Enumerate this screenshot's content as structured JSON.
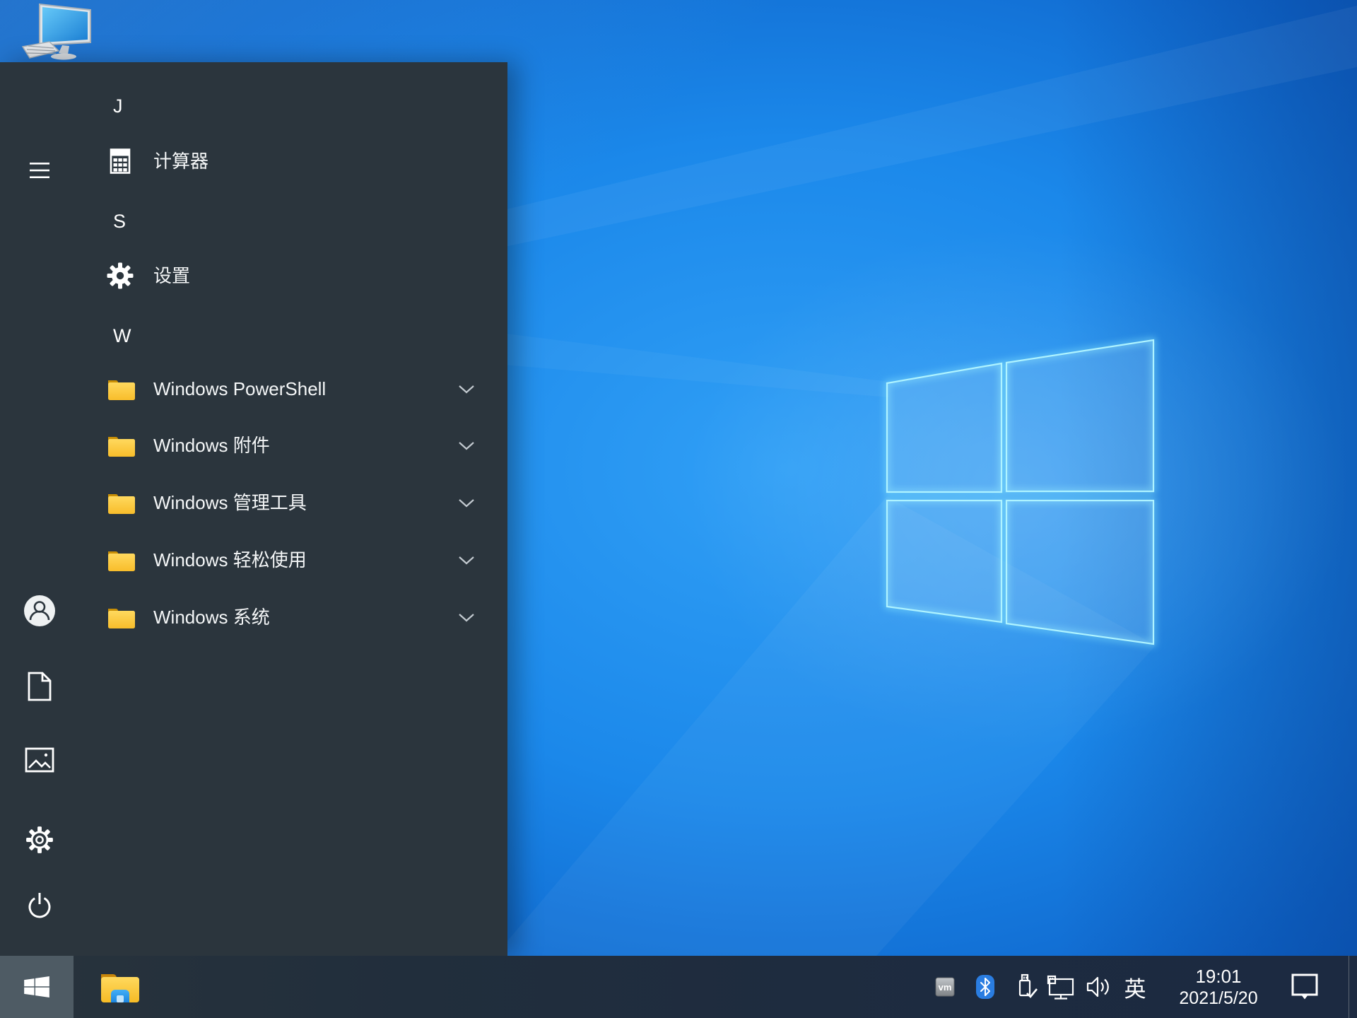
{
  "desktop": {
    "this_pc_icon": "this-pc-icon"
  },
  "start_menu": {
    "hamburger_icon": "hamburger-icon",
    "sections": [
      {
        "letter": "J"
      },
      {
        "letter": "S"
      },
      {
        "letter": "W"
      }
    ],
    "apps": [
      {
        "label": "计算器",
        "icon": "calculator-icon",
        "section": "J"
      },
      {
        "label": "设置",
        "icon": "gear-icon",
        "section": "S"
      }
    ],
    "folders": [
      {
        "label": "Windows PowerShell",
        "icon": "folder-icon",
        "expandable": true
      },
      {
        "label": "Windows 附件",
        "icon": "folder-icon",
        "expandable": true
      },
      {
        "label": "Windows 管理工具",
        "icon": "folder-icon",
        "expandable": true
      },
      {
        "label": "Windows 轻松使用",
        "icon": "folder-icon",
        "expandable": true
      },
      {
        "label": "Windows 系统",
        "icon": "folder-icon",
        "expandable": true
      }
    ],
    "rail": [
      {
        "icon": "user-avatar-icon"
      },
      {
        "icon": "documents-icon"
      },
      {
        "icon": "pictures-icon"
      },
      {
        "icon": "settings-gear-icon"
      },
      {
        "icon": "power-icon"
      }
    ]
  },
  "taskbar": {
    "start_icon": "windows-logo-icon",
    "explorer_icon": "file-explorer-icon",
    "tray": {
      "vm_label": "vm",
      "icons": [
        "vmware-icon",
        "bluetooth-icon",
        "usb-eject-icon",
        "network-icon",
        "volume-icon"
      ],
      "ime": "英"
    },
    "clock": {
      "time": "19:01",
      "date": "2021/5/20"
    },
    "action_center_icon": "action-center-icon"
  },
  "colors": {
    "menu_bg": "#2b353d",
    "taskbar_bg": "#1e2c3e",
    "start_button_highlight": "#4e5b64",
    "wallpaper_blue": "#1787e8",
    "logo_edge_cyan": "#aef3ff",
    "folder_yellow": "#fccf4e",
    "bluetooth_blue": "#2a7de1"
  }
}
